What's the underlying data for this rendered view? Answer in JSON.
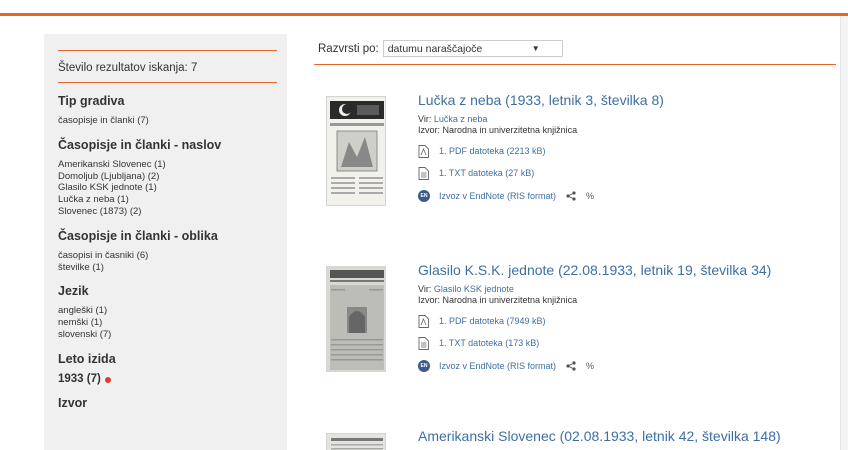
{
  "sidebar": {
    "count_label": "Število rezultatov iskanja: 7",
    "facets": [
      {
        "title": "Tip gradiva",
        "items": [
          "časopisje in članki (7)"
        ]
      },
      {
        "title": "Časopisje in članki - naslov",
        "items": [
          "Amerikanski Slovenec (1)",
          "Domoljub (Ljubljana) (2)",
          "Glasilo KSK jednote (1)",
          "Lučka z neba (1)",
          "Slovenec (1873) (2)"
        ]
      },
      {
        "title": "Časopisje in članki - oblika",
        "items": [
          "časopisi in časniki (6)",
          "številke (1)"
        ]
      },
      {
        "title": "Jezik",
        "items": [
          "angleški (1)",
          "nemški (1)",
          "slovenski (7)"
        ]
      },
      {
        "title": "Leto izida",
        "year": "1933 (7)"
      },
      {
        "title": "Izvor"
      }
    ]
  },
  "sort": {
    "label": "Razvrsti po:",
    "value": "datumu naraščajoče"
  },
  "results": [
    {
      "title": "Lučka z neba (1933, letnik 3, številka 8)",
      "vir_label": "Vir:",
      "vir": "Lučka z neba",
      "izvor": "Izvor: Narodna in univerzitetna knjižnica",
      "pdf": "1. PDF datoteka (2213 kB)",
      "txt": "1. TXT datoteka (27 kB)",
      "export": "Izvoz v EndNote (RIS format)"
    },
    {
      "title": "Glasilo K.S.K. jednote (22.08.1933, letnik 19, številka 34)",
      "vir_label": "Vir:",
      "vir": "Glasilo KSK jednote",
      "izvor": "Izvor: Narodna in univerzitetna knjižnica",
      "pdf": "1. PDF datoteka (7949 kB)",
      "txt": "1. TXT datoteka (173 kB)",
      "export": "Izvoz v EndNote (RIS format)"
    },
    {
      "title": "Amerikanski Slovenec (02.08.1933, letnik 42, številka 148)"
    }
  ],
  "icons": {
    "pdf": "pdf-file-icon",
    "txt": "text-file-icon",
    "endnote": "endnote-icon",
    "share": "share-icon",
    "link": "link-icon"
  },
  "colors": {
    "accent": "#e8642a",
    "link": "#3d6fa3",
    "sidebar_bg": "#f0f0f0",
    "endnote": "#3d5b8a",
    "dot": "#e03b2d"
  }
}
